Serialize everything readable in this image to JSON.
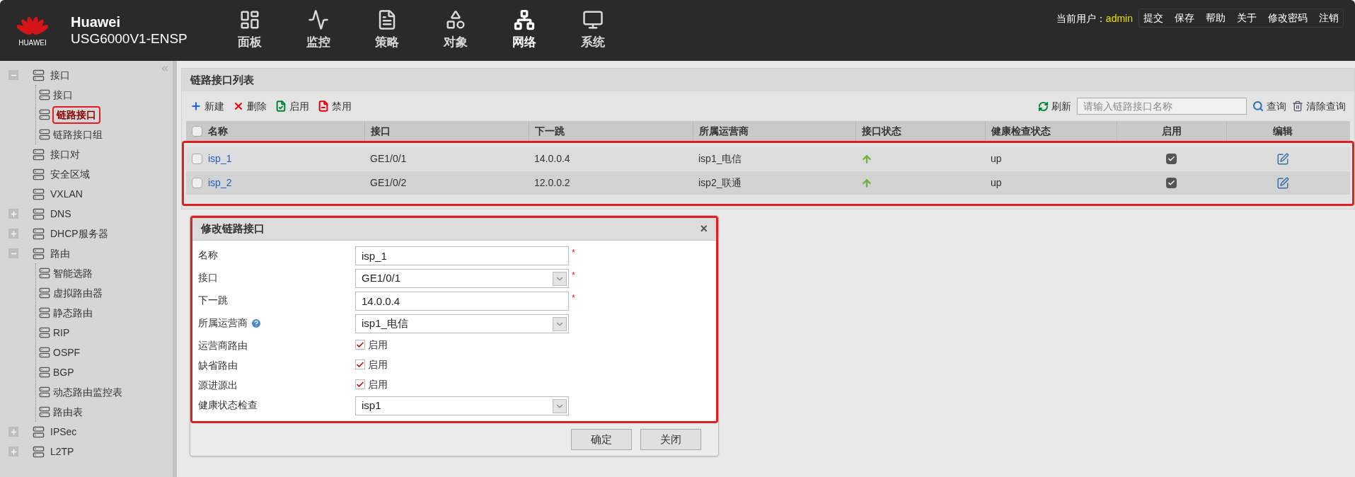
{
  "header": {
    "logo_text": "HUAWEI",
    "brand": "Huawei",
    "model": "USG6000V1-ENSP",
    "nav": [
      {
        "label": "面板",
        "selected": false
      },
      {
        "label": "监控",
        "selected": false
      },
      {
        "label": "策略",
        "selected": false
      },
      {
        "label": "对象",
        "selected": false
      },
      {
        "label": "网络",
        "selected": true
      },
      {
        "label": "系统",
        "selected": false
      }
    ],
    "user_label": "当前用户：",
    "user": "admin",
    "links": [
      "提交",
      "保存",
      "帮助",
      "关于",
      "修改密码",
      "注销"
    ]
  },
  "sidebar": {
    "items": [
      {
        "label": "接口",
        "expanded": true,
        "children": [
          {
            "label": "接口",
            "selected": false
          },
          {
            "label": "链路接口",
            "selected": true
          },
          {
            "label": "链路接口组",
            "selected": false
          }
        ]
      },
      {
        "label": "接口对"
      },
      {
        "label": "安全区域"
      },
      {
        "label": "VXLAN"
      },
      {
        "label": "DNS",
        "expanded": false
      },
      {
        "label": "DHCP服务器",
        "expanded": false
      },
      {
        "label": "路由",
        "expanded": true,
        "children": [
          {
            "label": "智能选路",
            "selected": false
          },
          {
            "label": "虚拟路由器",
            "selected": false
          },
          {
            "label": "静态路由",
            "selected": false
          },
          {
            "label": "RIP",
            "selected": false
          },
          {
            "label": "OSPF",
            "selected": false
          },
          {
            "label": "BGP",
            "selected": false
          },
          {
            "label": "动态路由监控表",
            "selected": false
          },
          {
            "label": "路由表",
            "selected": false
          }
        ]
      },
      {
        "label": "IPSec",
        "expanded": false
      },
      {
        "label": "L2TP",
        "expanded": false
      }
    ]
  },
  "panel": {
    "title": "链路接口列表",
    "toolbar": [
      "新建",
      "删除",
      "启用",
      "禁用"
    ],
    "refresh": "刷新",
    "search": {
      "placeholder": "请输入链路接口名称"
    },
    "query": "查询",
    "clear": "清除查询"
  },
  "table": {
    "all_selected": false,
    "columns": [
      "名称",
      "接口",
      "下一跳",
      "所属运营商",
      "接口状态",
      "健康检查状态",
      "启用",
      "编辑"
    ],
    "rows": [
      {
        "selected": false,
        "name": "isp_1",
        "interface": "GE1/0/1",
        "next_hop": "14.0.0.4",
        "carrier": "isp1_电信",
        "link_up": true,
        "health": "up",
        "enabled": true
      },
      {
        "selected": false,
        "name": "isp_2",
        "interface": "GE1/0/2",
        "next_hop": "12.0.0.2",
        "carrier": "isp2_联通",
        "link_up": true,
        "health": "up",
        "enabled": true
      }
    ]
  },
  "dialog": {
    "title": "修改链路接口",
    "close": "×",
    "fields": [
      {
        "kind": "text",
        "label": "名称",
        "value": "isp_1",
        "required_mark": "*",
        "help": false
      },
      {
        "kind": "select",
        "label": "接口",
        "value": "GE1/0/1",
        "required_mark": "*",
        "help": false
      },
      {
        "kind": "text",
        "label": "下一跳",
        "value": "14.0.0.4",
        "required_mark": "*",
        "help": false
      },
      {
        "kind": "select",
        "label": "所属运营商",
        "value": "isp1_电信",
        "help": true
      },
      {
        "kind": "checkbox",
        "label": "运营商路由",
        "text": "启用",
        "checked": true,
        "help": false
      },
      {
        "kind": "checkbox",
        "label": "缺省路由",
        "text": "启用",
        "checked": true,
        "help": false
      },
      {
        "kind": "checkbox",
        "label": "源进源出",
        "text": "启用",
        "checked": true,
        "help": false
      },
      {
        "kind": "select",
        "label": "健康状态检查",
        "value": "isp1",
        "help": false
      }
    ],
    "buttons": [
      "确定",
      "关闭"
    ]
  }
}
